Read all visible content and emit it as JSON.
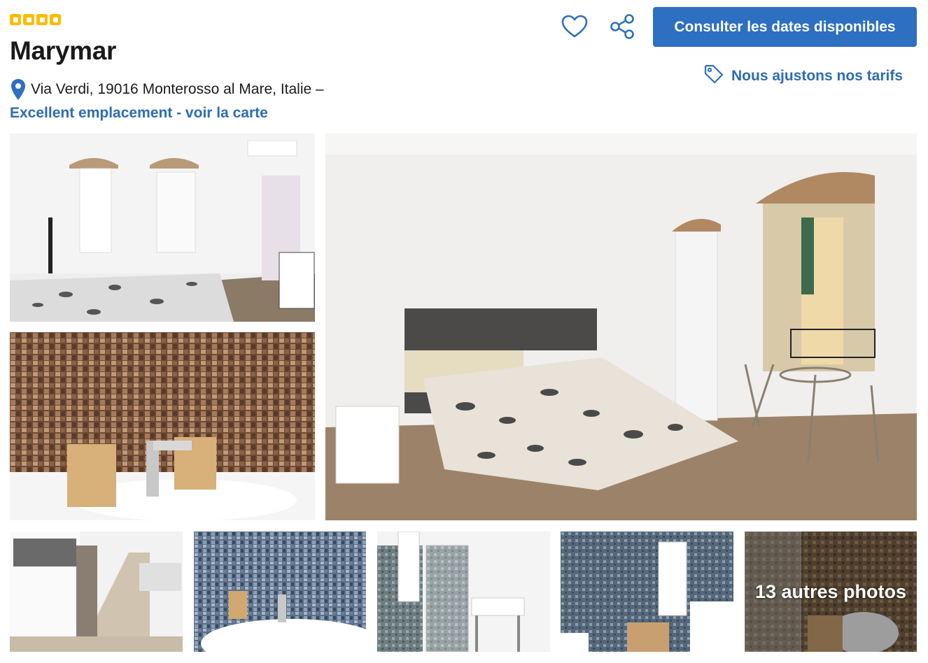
{
  "property": {
    "stars": 4,
    "name": "Marymar",
    "address": "Via Verdi, 19016 Monterosso al Mare, Italie –",
    "map_link": "Excellent emplacement - voir la carte"
  },
  "actions": {
    "heart_icon": "heart-icon",
    "share_icon": "share-icon",
    "cta_label": "Consulter les dates disponibles",
    "price_match_label": "Nous ajustons nos tarifs",
    "price_match_icon": "tag-icon"
  },
  "gallery": {
    "main_photos": [
      "bedroom-wide",
      "bathroom-tiles-sink",
      "bedroom-main"
    ],
    "thumbnails": [
      "staircase",
      "sink-blue-tiles",
      "shower",
      "towel-rack",
      "shower-toilet"
    ],
    "more_photos_label": "13 autres photos"
  },
  "colors": {
    "brand_blue": "#2d6fc0",
    "link_blue": "#2e6cb5",
    "star_yellow": "#febb02"
  }
}
